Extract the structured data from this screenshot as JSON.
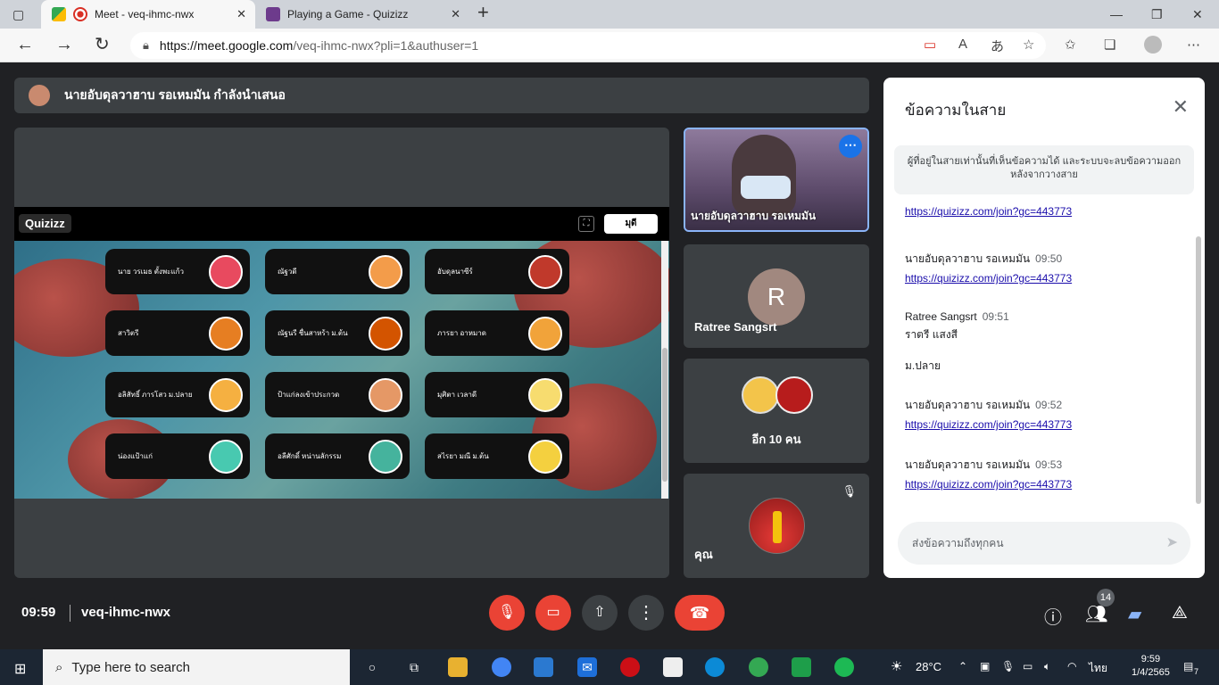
{
  "browser": {
    "tabs": [
      {
        "title": "Meet - veq-ihmc-nwx",
        "active": true
      },
      {
        "title": "Playing a Game - Quizizz",
        "active": false
      }
    ],
    "url_host": "https://meet.google.com",
    "url_path": "/veq-ihmc-nwx?pli=1&authuser=1"
  },
  "meet": {
    "presenting_banner": "นายอับดุลวาฮาบ รอเหมมัน กำลังนำเสนอ",
    "quizizz": {
      "logo": "Quizizz",
      "button": "มุดี",
      "players": [
        {
          "name": "นาย วรเมธ ตั้งพะแก้ว"
        },
        {
          "name": "ณัฐวดี"
        },
        {
          "name": "อับดุลนาซีร์"
        },
        {
          "name": "สาวิตรี"
        },
        {
          "name": "ณัฐนรี ชื่นสาหร้า ม.ต้น"
        },
        {
          "name": "ภารยา อาหมาด"
        },
        {
          "name": "อลิสัทธิ์ ภารโสว ม.ปลาย"
        },
        {
          "name": "ป้าแก่ลงเข้าประกวด"
        },
        {
          "name": "มุศิตา เวลาดี"
        },
        {
          "name": "น่องแป้าแก่"
        },
        {
          "name": "อลีศักดิ์ หน่านลักรรม"
        },
        {
          "name": "สไรยา มณี ม.ต้น"
        }
      ]
    },
    "tiles": {
      "presenter_name": "นายอับดุลวาฮาบ รอเหมมัน",
      "ratree_initial": "R",
      "ratree_name": "Ratree Sangsrt",
      "others_label": "อีก 10 คน",
      "self_label": "คุณ"
    },
    "chat": {
      "title": "ข้อความในสาย",
      "notice": "ผู้ที่อยู่ในสายเท่านั้นที่เห็นข้อความได้ และระบบจะลบข้อความออกหลังจากวางสาย",
      "messages": [
        {
          "sender": "",
          "time": "",
          "link": "https://quizizz.com/join?gc=443773",
          "text": ""
        },
        {
          "sender": "นายอับดุลวาฮาบ รอเหมมัน",
          "time": "09:50",
          "link": "https://quizizz.com/join?gc=443773",
          "text": ""
        },
        {
          "sender": "Ratree Sangsrt",
          "time": "09:51",
          "link": "",
          "text": "ราตรี แสงสี"
        },
        {
          "sender": "",
          "time": "",
          "link": "",
          "text": "ม.ปลาย"
        },
        {
          "sender": "นายอับดุลวาฮาบ รอเหมมัน",
          "time": "09:52",
          "link": "https://quizizz.com/join?gc=443773",
          "text": ""
        },
        {
          "sender": "นายอับดุลวาฮาบ รอเหมมัน",
          "time": "09:53",
          "link": "https://quizizz.com/join?gc=443773",
          "text": ""
        }
      ],
      "input_placeholder": "ส่งข้อความถึงทุกคน"
    },
    "bottom": {
      "time": "09:59",
      "meeting_code": "veq-ihmc-nwx",
      "participants_count": "14"
    }
  },
  "taskbar": {
    "search_placeholder": "Type here to search",
    "weather": "28°C",
    "lang": "ไทย",
    "clock_time": "9:59",
    "clock_date": "1/4/2565",
    "notif_count": "7"
  }
}
